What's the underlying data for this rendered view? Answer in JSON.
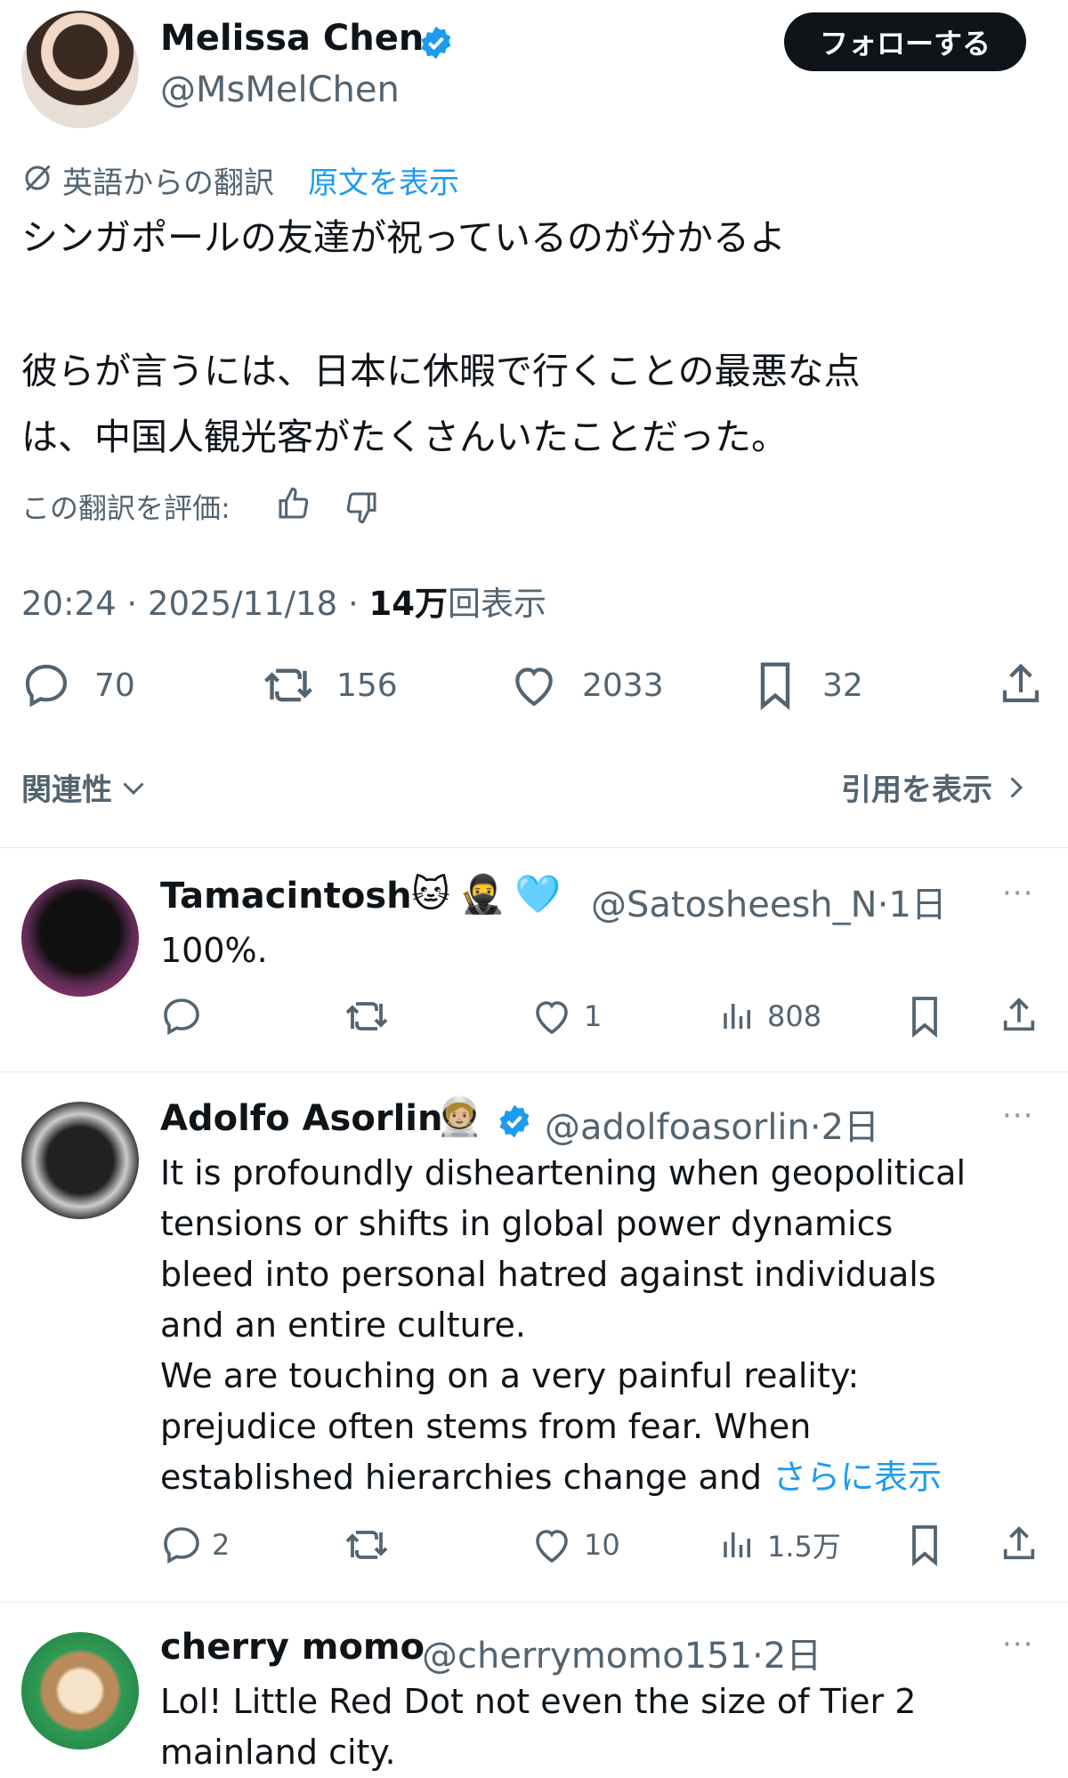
{
  "tweet": {
    "author_name": "Melissa Chen",
    "author_handle": "@MsMelChen",
    "follow_label": "フォローする",
    "translation_note": "英語からの翻訳",
    "show_original": "原文を表示",
    "text_lines": [
      "シンガポールの友達が祝っているのが分かるよ",
      "彼らが言うには、日本に休暇で行くことの最悪な点",
      "は、中国人観光客がたくさんいたことだった。"
    ],
    "rate_translation": "この翻訳を評価:",
    "time": "20:24",
    "date": "2025/11/18",
    "views_count": "14万",
    "views_label": "回表示",
    "replies": "70",
    "retweets": "156",
    "likes": "2033",
    "bookmarks": "32"
  },
  "sort": {
    "label": "関連性",
    "quotes_label": "引用を表示"
  },
  "replies": [
    {
      "name": "Tamacintosh",
      "emojis": "🐱🥷🩵",
      "handle": "@Satosheesh_N",
      "time": "1日",
      "text_lines": [
        "100%."
      ],
      "reply_count": "",
      "retweet_count": "",
      "like_count": "1",
      "view_count": "808",
      "verified": false
    },
    {
      "name": "Adolfo Asorlin",
      "emojis": "🧑🏼‍🚀",
      "handle": "@adolfoasorlin",
      "time": "2日",
      "text_lines": [
        "It is profoundly disheartening when geopolitical",
        "tensions or shifts in global power dynamics",
        "bleed into personal hatred against individuals",
        "and an entire culture.",
        "We are touching on a very painful reality:",
        "prejudice often stems from fear. When",
        "established hierarchies change and "
      ],
      "show_more": "さらに表示",
      "reply_count": "2",
      "retweet_count": "",
      "like_count": "10",
      "view_count": "1.5万",
      "verified": true
    },
    {
      "name": "cherry momo",
      "emojis": "",
      "handle": "@cherrymomo151",
      "time": "2日",
      "text_lines": [
        "Lol! Little Red Dot not even the size of Tier 2",
        "mainland city."
      ],
      "verified": false
    }
  ],
  "colors": {
    "accent": "#1d9bf0",
    "text": "#0f1419",
    "muted": "#536471"
  }
}
